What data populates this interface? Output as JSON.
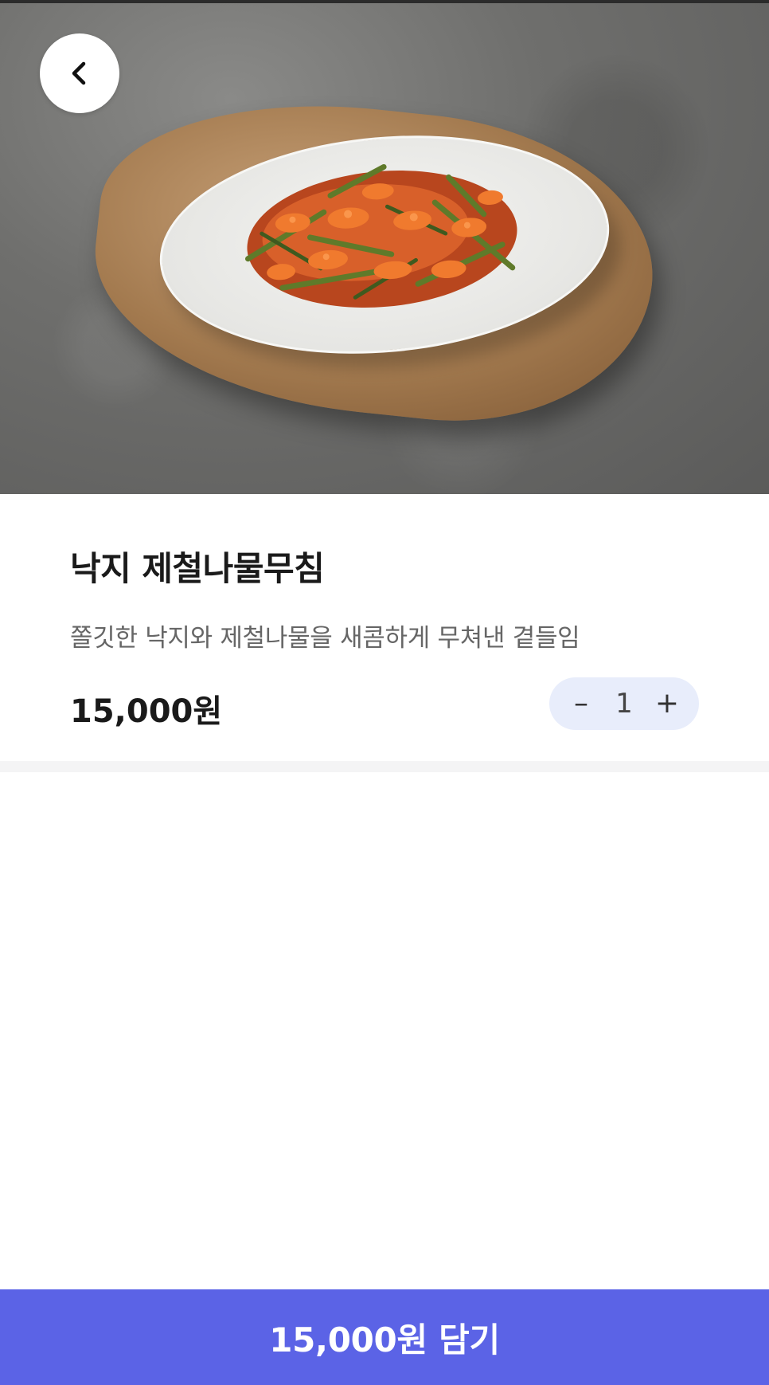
{
  "product": {
    "name": "낙지 제철나물무침",
    "description": "쫄깃한 낙지와 제철나물을 새콤하게 무쳐낸 곁들임",
    "price": "15,000원"
  },
  "quantity": {
    "minus_label": "–",
    "value": "1",
    "plus_label": "+"
  },
  "cart_button": {
    "label": "15,000원 담기"
  },
  "icons": {
    "back": "chevron-left-icon",
    "minus": "minus-icon",
    "plus": "plus-icon"
  },
  "colors": {
    "accent": "#5b63e6",
    "stepper_bg": "#e8edfb"
  }
}
